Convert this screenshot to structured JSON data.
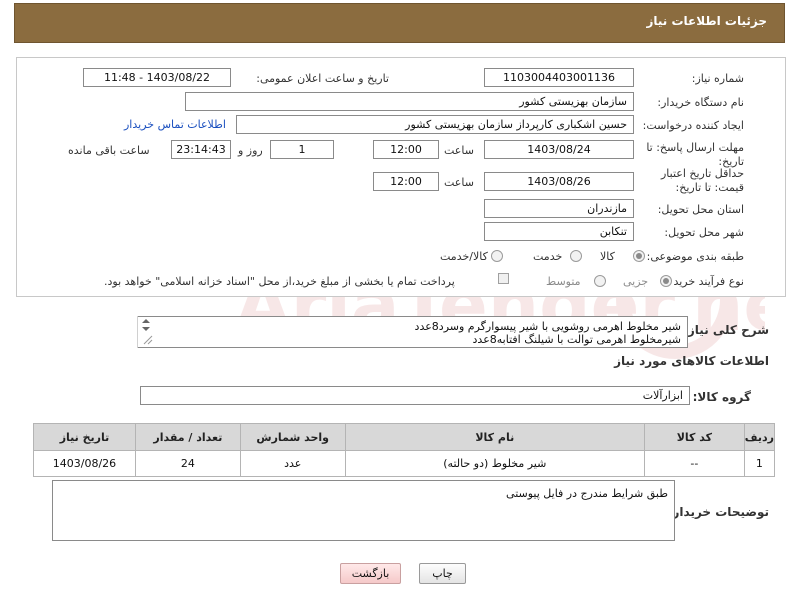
{
  "header": {
    "title": "جزئیات اطلاعات نیاز"
  },
  "form": {
    "need_number_label": "شماره نیاز:",
    "need_number": "1103004403001136",
    "announce_label": "تاریخ و ساعت اعلان عمومی:",
    "announce_value": "1403/08/22 - 11:48",
    "buyer_org_label": "نام دستگاه خریدار:",
    "buyer_org": "سازمان بهزیستی کشور",
    "requester_label": "ایجاد کننده درخواست:",
    "requester": "حسین اشکباری کارپرداز سازمان بهزیستی کشور",
    "contact_link": "اطلاعات تماس خریدار",
    "deadline_label": "مهلت ارسال پاسخ: تا تاریخ:",
    "deadline_date": "1403/08/24",
    "time_label": "ساعت",
    "deadline_time": "12:00",
    "days_value": "1",
    "days_label": "روز و",
    "remaining_value": "23:14:43",
    "remaining_label": "ساعت باقی مانده",
    "validity_label": "حداقل تاریخ اعتبار قیمت: تا تاریخ:",
    "validity_date": "1403/08/26",
    "validity_time": "12:00",
    "province_label": "استان محل تحویل:",
    "province": "مازندران",
    "city_label": "شهر محل تحویل:",
    "city": "تنکابن",
    "category_label": "طبقه بندی موضوعی:",
    "category_options": [
      "کالا",
      "خدمت",
      "کالا/خدمت"
    ],
    "process_label": "نوع فرآیند خرید :",
    "process_options": [
      "جزیی",
      "متوسط"
    ],
    "payment_note": "پرداخت تمام یا بخشی از مبلغ خرید،از محل \"اسناد خزانه اسلامی\" خواهد بود."
  },
  "description": {
    "label": "شرح کلی نیاز:",
    "line1": "شیر مخلوط اهرمی روشویی با شیر پیسوارگرم وسرد8عدد",
    "line2": "شیرمخلوط اهرمی توالت با شیلنگ افتابه8عدد"
  },
  "goods_section": {
    "title": "اطلاعات کالاهای مورد نیاز",
    "group_label": "گروه کالا:",
    "group_value": "ابزارآلات"
  },
  "table": {
    "headers": [
      "ردیف",
      "کد کالا",
      "نام کالا",
      "واحد شمارش",
      "تعداد / مقدار",
      "تاریخ نیاز"
    ],
    "rows": [
      [
        "1",
        "--",
        "شیر مخلوط (دو حالته)",
        "عدد",
        "24",
        "1403/08/26"
      ]
    ]
  },
  "buyer_notes": {
    "label": "توضیحات خریدار:",
    "value": "طبق شرایط مندرج در فایل پیوستی"
  },
  "buttons": {
    "print": "چاپ",
    "back": "بازگشت"
  },
  "watermark": {
    "text": "AriaTender.net"
  }
}
